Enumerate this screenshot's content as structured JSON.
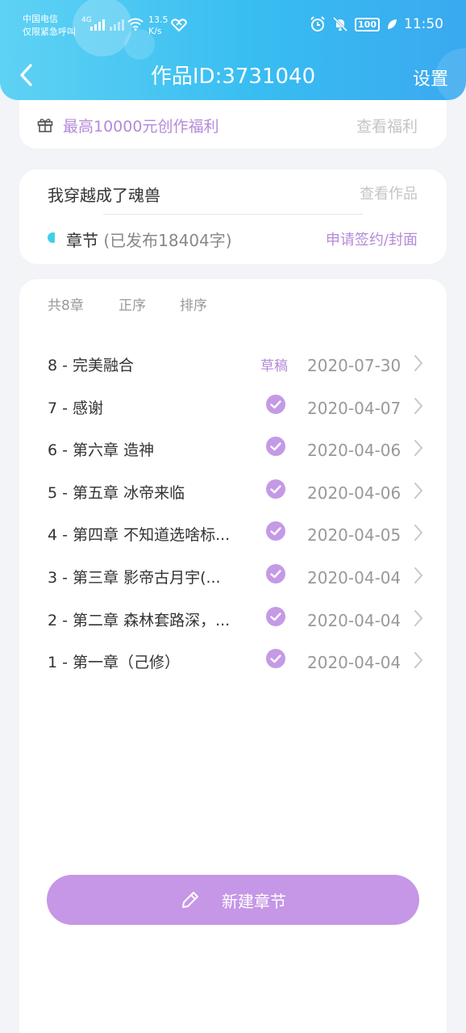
{
  "status_bar": {
    "carrier_line1": "中国电信",
    "carrier_line2": "仅限紧急呼叫",
    "net_type": "4G",
    "speed_value": "13.5",
    "speed_unit": "K/s",
    "battery": "100",
    "time": "11:50",
    "icons": [
      "hd-icon",
      "signal-icon",
      "no-signal-icon",
      "wifi-icon",
      "hotspot-icon",
      "alarm-icon",
      "mute-icon",
      "battery-icon",
      "leaf-icon"
    ]
  },
  "header": {
    "title": "作品ID:3731040",
    "settings_label": "设置"
  },
  "welfare": {
    "text": "最高10000元创作福利",
    "link": "查看福利"
  },
  "work": {
    "name": "我穿越成了魂兽",
    "view_link": "查看作品",
    "chapter_label": "章节",
    "published_info": "(已发布18404字)",
    "apply_link": "申请签约/封面"
  },
  "list_controls": {
    "count": "共8章",
    "order": "正序",
    "sort": "排序"
  },
  "chapters": [
    {
      "title": "8 - 完美融合",
      "status": "草稿",
      "date": "2020-07-30"
    },
    {
      "title": "7 - 感谢",
      "status": "published",
      "date": "2020-04-07"
    },
    {
      "title": "6 - 第六章  造神",
      "status": "published",
      "date": "2020-04-06"
    },
    {
      "title": "5 - 第五章  冰帝来临",
      "status": "published",
      "date": "2020-04-06"
    },
    {
      "title": "4 - 第四章  不知道选啥标...",
      "status": "published",
      "date": "2020-04-05"
    },
    {
      "title": "3 - 第三章  影帝古月宇(...",
      "status": "published",
      "date": "2020-04-04"
    },
    {
      "title": "2 - 第二章  森林套路深，...",
      "status": "published",
      "date": "2020-04-04"
    },
    {
      "title": "1 - 第一章（己修）",
      "status": "published",
      "date": "2020-04-04"
    }
  ],
  "new_chapter_label": "新建章节",
  "colors": {
    "header_gradient_start": "#5fd2f4",
    "header_gradient_end": "#3aa9f0",
    "accent_purple": "#b48ad8",
    "button_purple": "#c597e6",
    "check_purple": "#c49ae6"
  }
}
